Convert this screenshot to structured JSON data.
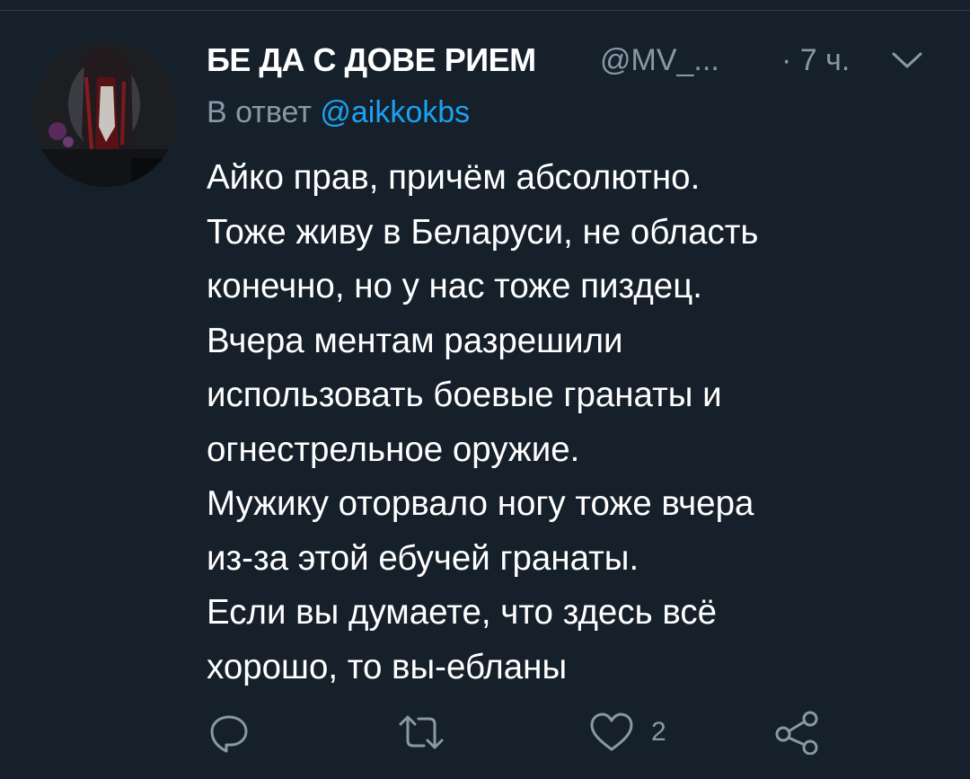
{
  "tweet": {
    "display_name": "БЕ ДА С ДОВЕ РИЕМ",
    "handle": "@MV_...",
    "time": "· 7 ч.",
    "reply_prefix": "В ответ",
    "reply_mention": "@aikkokbs",
    "text_lines": [
      "Айко прав, причём абсолютно.",
      "Тоже живу в Беларуси, не область",
      "конечно, но у нас тоже пиздец.",
      "Вчера ментам разрешили",
      "использовать боевые гранаты и",
      "огнестрельное оружие.",
      "Мужику оторвало ногу тоже вчера",
      "из-за этой ебучей гранаты.",
      "Если вы думаете, что здесь всё",
      "хорошо, то вы-ебланы"
    ]
  },
  "actions": {
    "like_count": "2",
    "icons": [
      "reply-icon",
      "retweet-icon",
      "like-icon",
      "share-icon"
    ]
  },
  "colors": {
    "background": "#15202b",
    "primary_text": "#ffffff",
    "secondary_text": "#8899a6",
    "accent": "#1da1f2"
  }
}
